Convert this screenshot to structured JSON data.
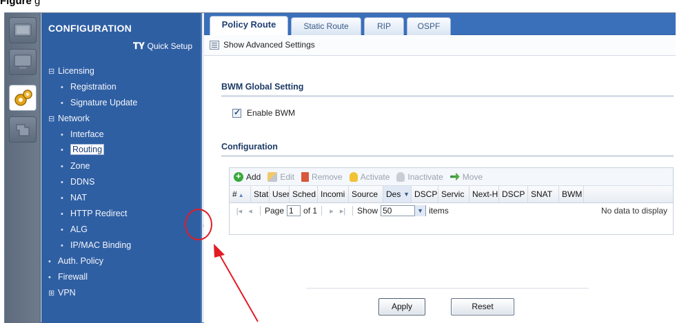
{
  "caption": {
    "label": "Figure",
    "text": "g"
  },
  "navigation": {
    "title": "CONFIGURATION",
    "quick_setup": "Quick Setup",
    "items": [
      {
        "label": "Licensing",
        "glyph": "⊟"
      },
      {
        "label": "Registration",
        "glyph": "•"
      },
      {
        "label": "Signature Update",
        "glyph": "•"
      },
      {
        "label": "Network",
        "glyph": "⊟"
      },
      {
        "label": "Interface",
        "glyph": "•"
      },
      {
        "label": "Routing",
        "glyph": "•"
      },
      {
        "label": "Zone",
        "glyph": "•"
      },
      {
        "label": "DDNS",
        "glyph": "•"
      },
      {
        "label": "NAT",
        "glyph": "•"
      },
      {
        "label": "HTTP Redirect",
        "glyph": "•"
      },
      {
        "label": "ALG",
        "glyph": "•"
      },
      {
        "label": "IP/MAC Binding",
        "glyph": "•"
      },
      {
        "label": "Auth. Policy",
        "glyph": "•"
      },
      {
        "label": "Firewall",
        "glyph": "•"
      },
      {
        "label": "VPN",
        "glyph": "⊞"
      }
    ],
    "selected": "Routing"
  },
  "tabs": [
    "Policy Route",
    "Static Route",
    "RIP",
    "OSPF"
  ],
  "advanced": {
    "label": "Show Advanced Settings"
  },
  "bwm": {
    "title": "BWM Global Setting",
    "checkbox_label": "Enable BWM",
    "checked": true
  },
  "configuration": {
    "title": "Configuration"
  },
  "toolbar": {
    "add": "Add",
    "edit": "Edit",
    "remove": "Remove",
    "activate": "Activate",
    "inactivate": "Inactivate",
    "move": "Move"
  },
  "columns": [
    "#",
    "Stat",
    "User",
    "Sched",
    "Incomi",
    "Source",
    "Des",
    "DSCP",
    "Servic",
    "Next-H",
    "DSCP",
    "SNAT",
    "BWM"
  ],
  "pager": {
    "page_label": "Page",
    "page_value": "1",
    "of_label": "of 1",
    "show_label": "Show",
    "show_value": "50",
    "items_label": "items",
    "no_data": "No data to display"
  },
  "buttons": {
    "apply": "Apply",
    "reset": "Reset"
  },
  "colors": {
    "nav_bg": "#2f5fa3",
    "tab_bar": "#3a6fba",
    "annotation": "#e31b23"
  },
  "icons": {
    "quick_setup": "tools-icon",
    "settings": "gear-icon"
  }
}
